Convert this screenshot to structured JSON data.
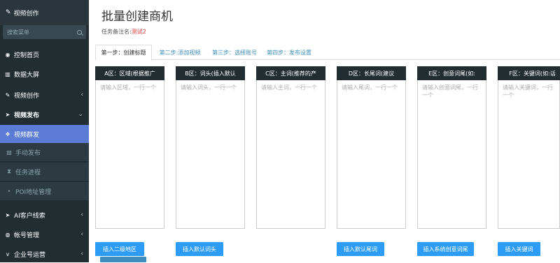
{
  "sidebar": {
    "header": "视频创作",
    "search_placeholder": "搜索菜单",
    "items": [
      {
        "label": "控制首页"
      },
      {
        "label": "数据大屏"
      },
      {
        "label": "视频创作"
      },
      {
        "label": "视频发布"
      },
      {
        "label": "视频群发"
      },
      {
        "label": "手动发布"
      },
      {
        "label": "任务进程"
      },
      {
        "label": "POI地址管理"
      },
      {
        "label": "AI客户线索"
      },
      {
        "label": "帐号管理"
      },
      {
        "label": "企业号运营"
      }
    ]
  },
  "page": {
    "title": "批量创建商机",
    "note_label": "任务备注名:",
    "note_value": "测试2"
  },
  "tabs": [
    {
      "label": "第一步：创建标题"
    },
    {
      "label": "第二步:添加视频"
    },
    {
      "label": "第三步：选择账号"
    },
    {
      "label": "第四步：发布设置"
    }
  ],
  "columns": [
    {
      "header": "A区：区域(根据推广",
      "placeholder": "请输入区域，一行一个"
    },
    {
      "header": "B区：词头(插入默认",
      "placeholder": "请输入词头，一行一个"
    },
    {
      "header": "C区：主词(推荐的产",
      "placeholder": "请输入主词，一行一个"
    },
    {
      "header": "D区：长尾词(建议",
      "placeholder": "请输入尾词，一行一个"
    },
    {
      "header": "E区：创意词尾(如:",
      "placeholder": "请输入创意词尾，一行一个"
    },
    {
      "header": "F区：关键词(如:话",
      "placeholder": "请输入关键词，一行一个"
    }
  ],
  "buttons": {
    "a": "插入二级地区",
    "b": "插入默认词头",
    "d": "插入默认尾词",
    "e": "插入系统创意词尾",
    "f": "插入关键词"
  },
  "colors": {
    "sidebar": "#222d32",
    "active": "#5b7bd5",
    "button": "#2d9cf6",
    "note_red": "#e53935"
  }
}
